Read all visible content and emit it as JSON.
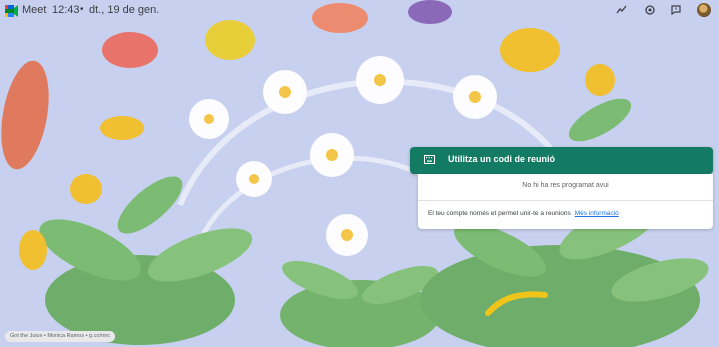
{
  "header": {
    "app_name": "Meet",
    "time": "12:43",
    "separator": "•",
    "date": "dt., 19 de gen.",
    "icons": [
      "activity-icon",
      "settings-icon",
      "feedback-icon",
      "avatar"
    ]
  },
  "card": {
    "code_button_label": "Utilitza un codi de reunió",
    "empty_message": "No hi ha res programat avui",
    "account_info": "El teu compte només et permet unir-te a reunions",
    "more_info_link": "Més informació"
  },
  "credit": "Got the Juice • Monica Ramos • g.co/mrc",
  "colors": {
    "background": "#c7d0ee",
    "button": "#137a63",
    "link": "#1a73e8"
  }
}
